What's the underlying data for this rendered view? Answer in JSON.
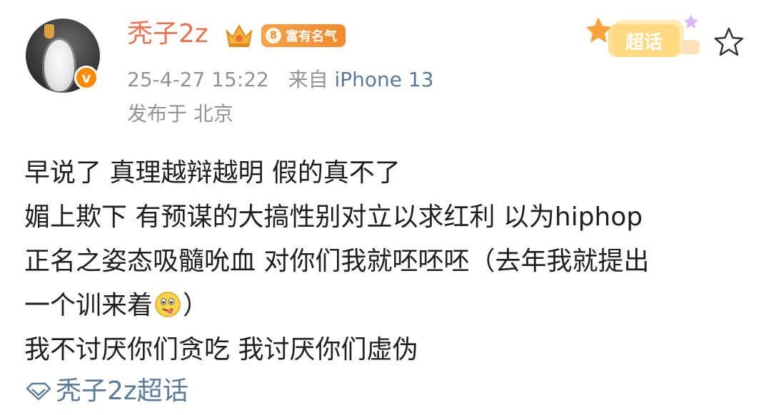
{
  "post": {
    "author": {
      "name": "秃子2z",
      "verified_badge": "v",
      "level": "8",
      "level_title": "富有名气"
    },
    "timestamp": "25-4-27 15:22",
    "source_prefix": "来自",
    "source_device": "iPhone 13",
    "location": "发布于 北京",
    "supertopic_badge_label": "超话",
    "body_lines": [
      "早说了 真理越辩越明 假的真不了",
      "媚上欺下 有预谋的大搞性别对立以求红利 以为hiphop",
      "正名之姿态吸髓吮血 对你们我就呸呸呸（去年我就提出",
      "一个训来着",
      "）",
      "我不讨厌你们贪吃 我讨厌你们虚伪"
    ],
    "topic_link": "秃子2z超话"
  },
  "colors": {
    "username": "#eb7350",
    "link": "#5b7a99",
    "meta": "#939393",
    "level_badge": "#f08a2e",
    "verified": "#ff8a00"
  },
  "icons": [
    "crown-icon",
    "level-badge-icon",
    "supertopic-icon",
    "star-icon",
    "drooling-face-emoji",
    "diamond-icon"
  ]
}
